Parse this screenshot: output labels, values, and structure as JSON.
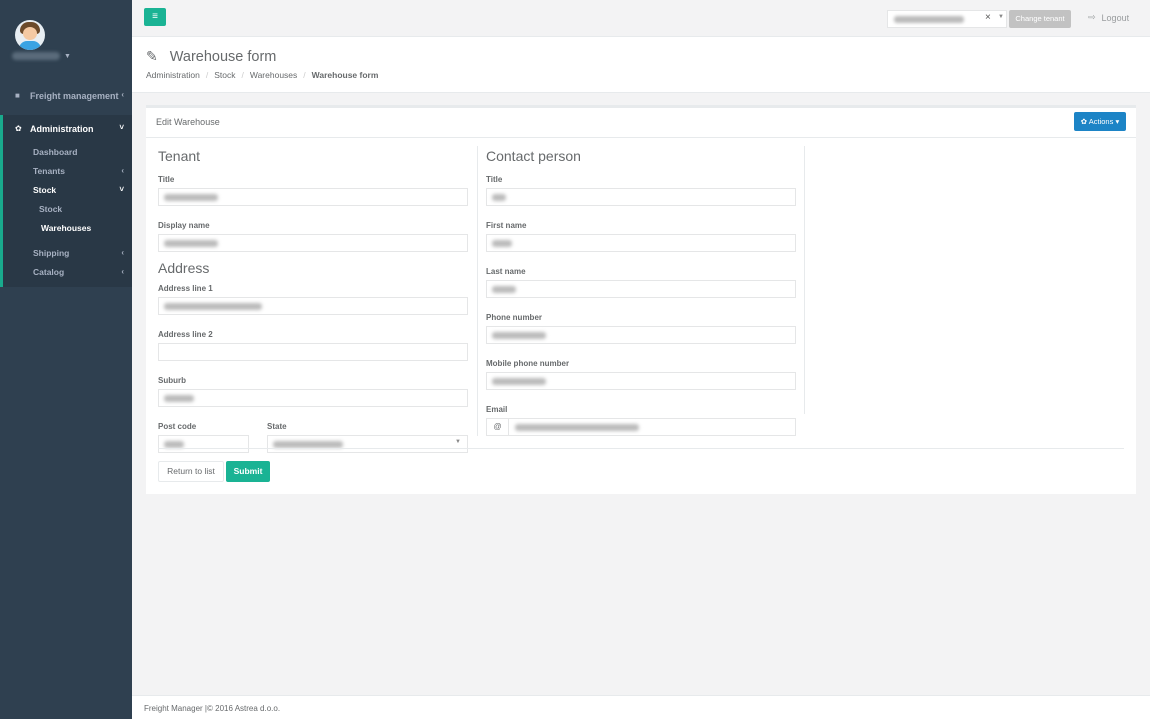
{
  "sidebar": {
    "freight_label": "Freight management",
    "admin_label": "Administration",
    "dashboard_label": "Dashboard",
    "tenants_label": "Tenants",
    "stock_label": "Stock",
    "stock_sub_label": "Stock",
    "warehouses_label": "Warehouses",
    "shipping_label": "Shipping",
    "catalog_label": "Catalog"
  },
  "topbar": {
    "change_tenant_label": "Change tenant",
    "logout_label": "Logout"
  },
  "heading": {
    "title": "Warehouse form",
    "breadcrumb": [
      "Administration",
      "Stock",
      "Warehouses",
      "Warehouse form"
    ]
  },
  "card": {
    "title": "Edit Warehouse",
    "actions_label": "Actions",
    "tenant_section": "Tenant",
    "title_label": "Title",
    "display_name_label": "Display name",
    "address_section": "Address",
    "address1_label": "Address line 1",
    "address2_label": "Address line 2",
    "suburb_label": "Suburb",
    "postcode_label": "Post code",
    "state_label": "State",
    "contact_section": "Contact person",
    "contact_title_label": "Title",
    "first_name_label": "First name",
    "last_name_label": "Last name",
    "phone_label": "Phone number",
    "mobile_label": "Mobile phone number",
    "email_label": "Email",
    "email_prefix": "@",
    "return_label": "Return to list",
    "submit_label": "Submit"
  },
  "footer": {
    "text": "Freight Manager |© 2016 Astrea d.o.o."
  },
  "colors": {
    "accent": "#1ab394",
    "sidebar": "#2f4050",
    "actions": "#1c84c6"
  }
}
